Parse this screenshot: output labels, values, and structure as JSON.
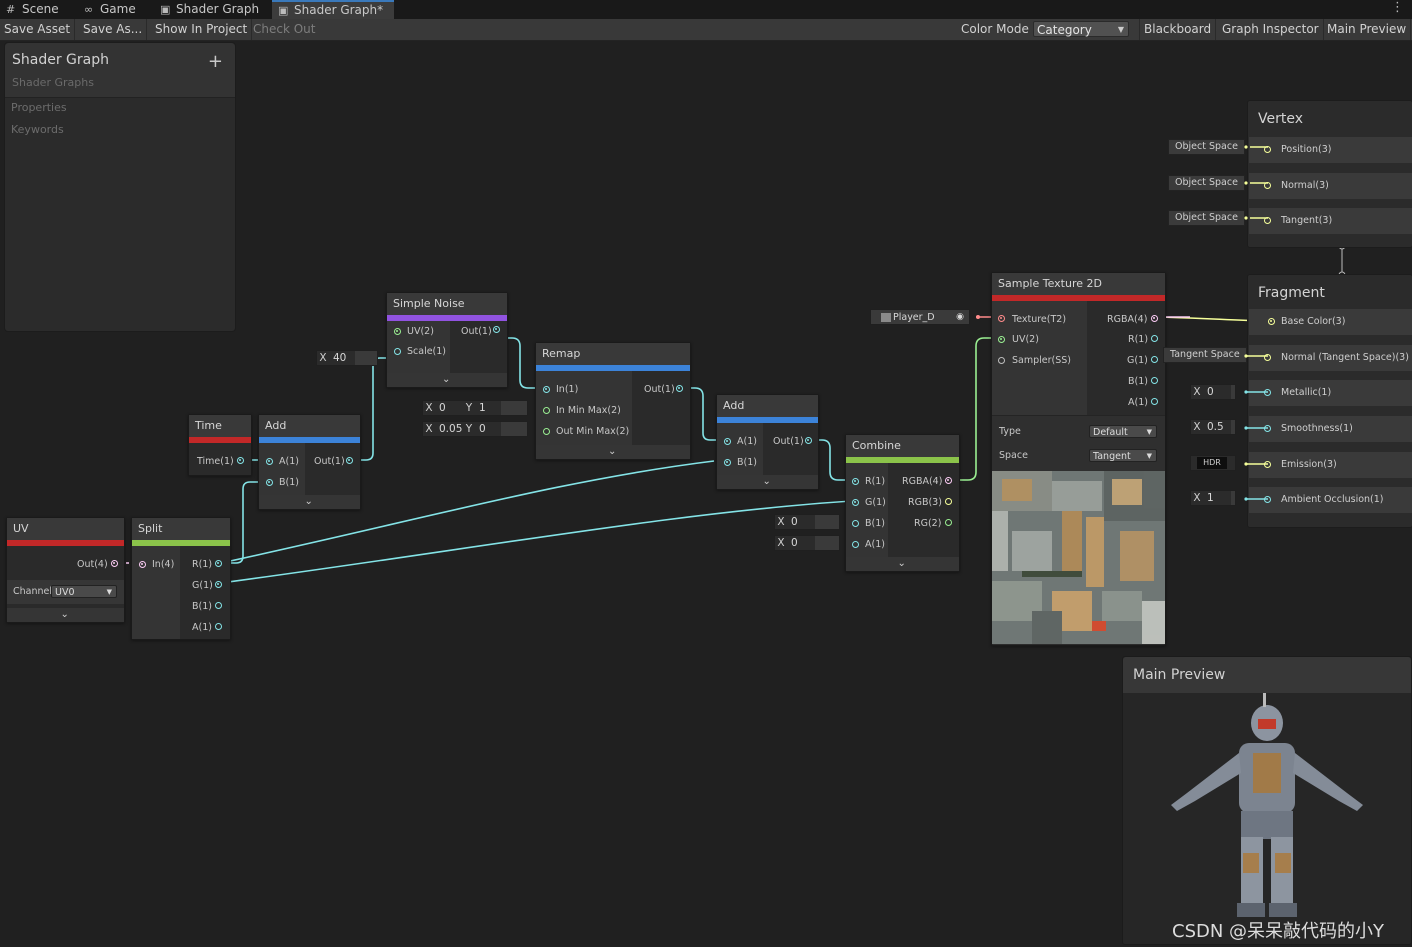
{
  "tabs": [
    {
      "label": "Scene",
      "icon": "grid-icon"
    },
    {
      "label": "Game",
      "icon": "gamepad-icon"
    },
    {
      "label": "Shader Graph",
      "icon": "shader-graph-icon"
    },
    {
      "label": "Shader Graph*",
      "icon": "shader-graph-icon"
    }
  ],
  "toolbar": {
    "save_asset": "Save Asset",
    "save_as": "Save As...",
    "show_in_project": "Show In Project",
    "check_out": "Check Out",
    "color_mode_label": "Color Mode",
    "color_mode_value": "Category",
    "blackboard": "Blackboard",
    "graph_inspector": "Graph Inspector",
    "main_preview": "Main Preview"
  },
  "blackboard": {
    "title": "Shader Graph",
    "subtitle": "Shader Graphs",
    "add": "+",
    "properties": "Properties",
    "keywords": "Keywords"
  },
  "nodes": {
    "simple_noise": {
      "title": "Simple Noise",
      "in1": "UV(2)",
      "in2": "Scale(1)",
      "out": "Out(1)",
      "scale_x": "X",
      "scale_value": "40"
    },
    "remap": {
      "title": "Remap",
      "in1": "In(1)",
      "in2": "In Min Max(2)",
      "in3": "Out Min Max(2)",
      "out": "Out(1)",
      "in_min_x": "X",
      "in_min_x_val": "0",
      "in_min_y": "Y",
      "in_min_y_val": "1",
      "out_min_x": "X",
      "out_min_x_val": "0.05",
      "out_min_y": "Y",
      "out_min_y_val": "0"
    },
    "time": {
      "title": "Time",
      "out": "Time(1)"
    },
    "add1": {
      "title": "Add",
      "in1": "A(1)",
      "in2": "B(1)",
      "out": "Out(1)"
    },
    "add2": {
      "title": "Add",
      "in1": "A(1)",
      "in2": "B(1)",
      "out": "Out(1)"
    },
    "uv": {
      "title": "UV",
      "out": "Out(4)",
      "channel_label": "Channel",
      "channel_value": "UV0"
    },
    "split": {
      "title": "Split",
      "in": "In(4)",
      "out_r": "R(1)",
      "out_g": "G(1)",
      "out_b": "B(1)",
      "out_a": "A(1)"
    },
    "combine": {
      "title": "Combine",
      "in_r": "R(1)",
      "in_g": "G(1)",
      "in_b": "B(1)",
      "in_a": "A(1)",
      "out_rgba": "RGBA(4)",
      "out_rgb": "RGB(3)",
      "out_rg": "RG(2)",
      "b_x": "X",
      "b_val": "0",
      "a_x": "X",
      "a_val": "0"
    },
    "sample_texture": {
      "title": "Sample Texture 2D",
      "in_tex": "Texture(T2)",
      "in_uv": "UV(2)",
      "in_sampler": "Sampler(SS)",
      "out_rgba": "RGBA(4)",
      "out_r": "R(1)",
      "out_g": "G(1)",
      "out_b": "B(1)",
      "out_a": "A(1)",
      "type_label": "Type",
      "type_value": "Default",
      "space_label": "Space",
      "space_value": "Tangent",
      "texture_asset": "Player_D"
    }
  },
  "master": {
    "vertex": {
      "title": "Vertex",
      "rows": [
        {
          "label": "Position(3)",
          "space": "Object Space"
        },
        {
          "label": "Normal(3)",
          "space": "Object Space"
        },
        {
          "label": "Tangent(3)",
          "space": "Object Space"
        }
      ]
    },
    "fragment": {
      "title": "Fragment",
      "base_color": "Base Color(3)",
      "normal": "Normal (Tangent Space)(3)",
      "normal_space": "Tangent Space",
      "metallic": "Metallic(1)",
      "metallic_x": "X",
      "metallic_val": "0",
      "smoothness": "Smoothness(1)",
      "smoothness_x": "X",
      "smoothness_val": "0.5",
      "emission": "Emission(3)",
      "emission_hdr": "HDR",
      "ao": "Ambient Occlusion(1)",
      "ao_x": "X",
      "ao_val": "1"
    }
  },
  "main_preview": {
    "title": "Main Preview"
  },
  "watermark": "CSDN @呆呆敲代码的小Y",
  "colors": {
    "float_port": "#84e4e7",
    "vector4_port": "#fbcbf4",
    "vector3_port": "#f6ff9a",
    "vector2_port": "#9aef92",
    "texture_port": "#ff8b8b",
    "sampler_port": "#9e9e9e",
    "time_bar": "#c22828",
    "uv_bar": "#c22828",
    "math_bar": "#3c83d9",
    "noise_bar": "#9153e0",
    "channel_bar": "#8bc34a",
    "texture_bar": "#c22828"
  }
}
